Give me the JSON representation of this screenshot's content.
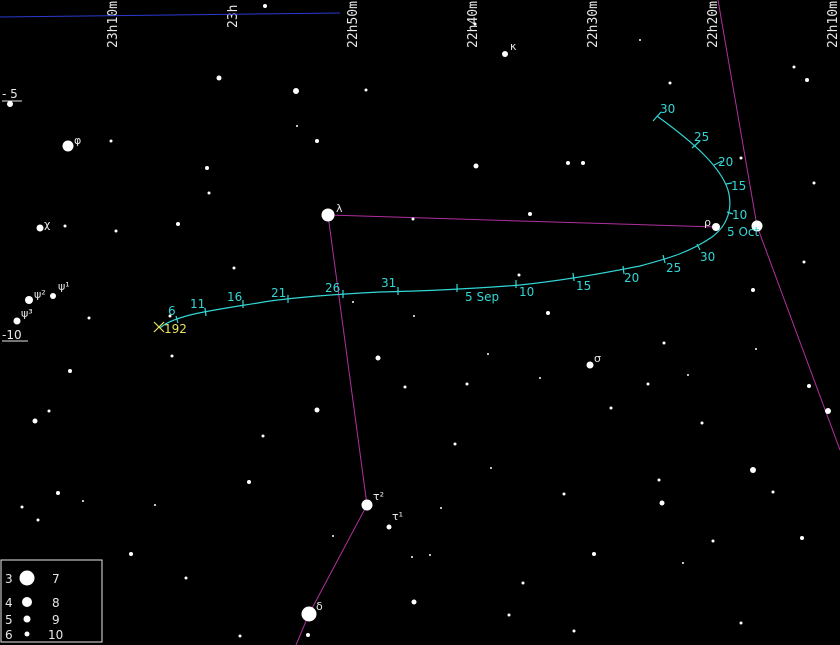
{
  "ra_labels": [
    "23h10m",
    "23h",
    "22h50m",
    "22h40m",
    "22h30m",
    "22h20m",
    "22h10m"
  ],
  "dec_labels": [
    "- 5",
    "-10"
  ],
  "path_labels": [
    "30",
    "25",
    "20",
    "15",
    "10",
    "5 Oct",
    "30",
    "25",
    "20",
    "15",
    "10",
    "5 Sep",
    "31",
    "26",
    "21",
    "16",
    "11",
    "6",
    "192"
  ],
  "star_labels": [
    "κ",
    "φ",
    "χ",
    "ψ²",
    "ψ¹",
    "ψ³",
    "λ",
    "ρ",
    "σ",
    "τ²",
    "τ¹",
    "δ"
  ],
  "legend": {
    "left": [
      "3",
      "4",
      "5",
      "6"
    ],
    "right": [
      "7",
      "8",
      "9",
      "10"
    ]
  },
  "colors": {
    "background": "#000000",
    "path": "#33d6d6",
    "constellation_lines": "#b0309e",
    "ecliptic": "#2a3ad0",
    "object_marker": "#e8e060",
    "stars": "#ffffff"
  }
}
